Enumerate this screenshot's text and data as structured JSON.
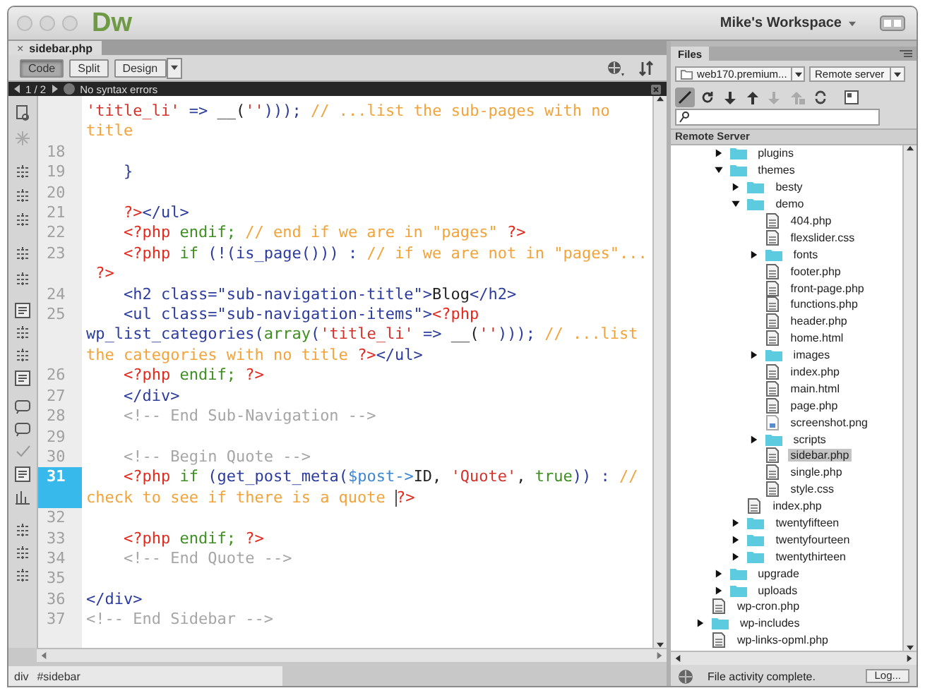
{
  "app": {
    "logo": "Dw",
    "workspace": "Mike's Workspace"
  },
  "document_tab": {
    "close": "×",
    "title": "sidebar.php"
  },
  "view_buttons": [
    {
      "label": "Code",
      "selected": true
    },
    {
      "label": "Split",
      "selected": false
    },
    {
      "label": "Design",
      "selected": false
    }
  ],
  "info_bar": {
    "page": "1 / 2",
    "message": "No syntax errors"
  },
  "code_rows": [
    {
      "current": false,
      "tokens": [
        {
          "kind": "string",
          "text": "'title_li'"
        },
        {
          "kind": "markup",
          "text": " => "
        },
        {
          "kind": "plain",
          "text": "__("
        },
        {
          "kind": "string",
          "text": "''"
        },
        {
          "kind": "markup",
          "text": ")));"
        },
        {
          "kind": "comment",
          "text": " // ...list the sub-pages with no"
        }
      ]
    },
    {
      "current": false,
      "tokens": [
        {
          "kind": "comment",
          "text": "title"
        }
      ]
    },
    {
      "number": "18",
      "current": false,
      "tokens": []
    },
    {
      "number": "19",
      "current": false,
      "tokens": [
        {
          "kind": "markup",
          "text": "    }"
        }
      ]
    },
    {
      "number": "20",
      "current": false,
      "tokens": []
    },
    {
      "number": "21",
      "current": false,
      "tokens": [
        {
          "kind": "tag",
          "text": "    ?>"
        },
        {
          "kind": "markup",
          "text": "</ul>"
        }
      ]
    },
    {
      "number": "22",
      "current": false,
      "tokens": [
        {
          "kind": "tag",
          "text": "    <?php"
        },
        {
          "kind": "keyword",
          "text": " endif;"
        },
        {
          "kind": "comment",
          "text": " // end if we are in \"pages\""
        },
        {
          "kind": "tag",
          "text": " ?>"
        }
      ]
    },
    {
      "number": "23",
      "current": false,
      "tokens": [
        {
          "kind": "tag",
          "text": "    <?php"
        },
        {
          "kind": "keyword",
          "text": " if"
        },
        {
          "kind": "markup",
          "text": " (!(is_page())) :"
        },
        {
          "kind": "comment",
          "text": " // if we are not in \"pages\"..."
        }
      ]
    },
    {
      "current": false,
      "tokens": [
        {
          "kind": "tag",
          "text": " ?>"
        }
      ]
    },
    {
      "number": "24",
      "current": false,
      "tokens": [
        {
          "kind": "markup",
          "text": "    <h2 class=\"sub-navigation-title\">"
        },
        {
          "kind": "plain",
          "text": "Blog"
        },
        {
          "kind": "markup",
          "text": "</h2>"
        }
      ]
    },
    {
      "number": "25",
      "current": false,
      "tokens": [
        {
          "kind": "markup",
          "text": "    <ul class=\"sub-navigation-items\">"
        },
        {
          "kind": "tag",
          "text": "<?php"
        }
      ]
    },
    {
      "current": false,
      "tokens": [
        {
          "kind": "markup",
          "text": "wp_list_categories("
        },
        {
          "kind": "keyword",
          "text": "array"
        },
        {
          "kind": "markup",
          "text": "("
        },
        {
          "kind": "string",
          "text": "'title_li'"
        },
        {
          "kind": "markup",
          "text": " => "
        },
        {
          "kind": "plain",
          "text": "__("
        },
        {
          "kind": "string",
          "text": "''"
        },
        {
          "kind": "markup",
          "text": ")));"
        },
        {
          "kind": "comment",
          "text": " // ...list"
        }
      ]
    },
    {
      "current": false,
      "tokens": [
        {
          "kind": "comment",
          "text": "the categories with no title "
        },
        {
          "kind": "tag",
          "text": "?>"
        },
        {
          "kind": "markup",
          "text": "</ul>"
        }
      ]
    },
    {
      "number": "26",
      "current": false,
      "tokens": [
        {
          "kind": "tag",
          "text": "    <?php"
        },
        {
          "kind": "keyword",
          "text": " endif;"
        },
        {
          "kind": "tag",
          "text": " ?>"
        }
      ]
    },
    {
      "number": "27",
      "current": false,
      "tokens": [
        {
          "kind": "markup",
          "text": "    </div>"
        }
      ]
    },
    {
      "number": "28",
      "current": false,
      "tokens": [
        {
          "kind": "htmlcomment",
          "text": "    <!-- End Sub-Navigation -->"
        }
      ]
    },
    {
      "number": "29",
      "current": false,
      "tokens": []
    },
    {
      "number": "30",
      "current": false,
      "tokens": [
        {
          "kind": "htmlcomment",
          "text": "    <!-- Begin Quote -->"
        }
      ]
    },
    {
      "number": "31",
      "current": true,
      "tokens": [
        {
          "kind": "tag",
          "text": "    <?php"
        },
        {
          "kind": "keyword",
          "text": " if"
        },
        {
          "kind": "markup",
          "text": " (get_post_meta("
        },
        {
          "kind": "variable",
          "text": "$post->"
        },
        {
          "kind": "plain",
          "text": "ID, "
        },
        {
          "kind": "string",
          "text": "'Quote'"
        },
        {
          "kind": "plain",
          "text": ", "
        },
        {
          "kind": "keyword",
          "text": "true"
        },
        {
          "kind": "markup",
          "text": ")) :"
        },
        {
          "kind": "comment",
          "text": " //"
        }
      ]
    },
    {
      "current": true,
      "tokens": [
        {
          "kind": "comment",
          "text": "check to see if there is a quote "
        },
        {
          "kind": "tag",
          "text": "?>",
          "caret": true
        }
      ]
    },
    {
      "number": "32",
      "current": false,
      "tokens": []
    },
    {
      "number": "33",
      "current": false,
      "tokens": [
        {
          "kind": "tag",
          "text": "    <?php"
        },
        {
          "kind": "keyword",
          "text": " endif;"
        },
        {
          "kind": "tag",
          "text": " ?>"
        }
      ]
    },
    {
      "number": "34",
      "current": false,
      "tokens": [
        {
          "kind": "htmlcomment",
          "text": "    <!-- End Quote -->"
        }
      ]
    },
    {
      "number": "35",
      "current": false,
      "tokens": []
    },
    {
      "number": "36",
      "current": false,
      "tokens": [
        {
          "kind": "markup",
          "text": "</div>"
        }
      ]
    },
    {
      "number": "37",
      "current": false,
      "tokens": [
        {
          "kind": "htmlcomment",
          "text": "<!-- End Sidebar -->"
        }
      ]
    }
  ],
  "tag_selector": [
    "div",
    "#sidebar"
  ],
  "files_panel": {
    "tab": "Files",
    "site": "web170.premium...",
    "server_view": "Remote server",
    "header": "Remote Server",
    "tree": {
      "continued": [
        {
          "kind": "folder",
          "label": "plugins",
          "expanded": false,
          "selected": false
        },
        {
          "kind": "folder",
          "label": "themes",
          "expanded": true,
          "selected": false,
          "children": [
            {
              "kind": "folder",
              "label": "besty",
              "expanded": false,
              "selected": false
            },
            {
              "kind": "folder",
              "label": "demo",
              "expanded": true,
              "selected": false,
              "children": [
                {
                  "kind": "file",
                  "label": "404.php",
                  "selected": false
                },
                {
                  "kind": "file",
                  "label": "flexslider.css",
                  "selected": false
                },
                {
                  "kind": "folder",
                  "label": "fonts",
                  "expanded": false,
                  "selected": false
                },
                {
                  "kind": "file",
                  "label": "footer.php",
                  "selected": false
                },
                {
                  "kind": "file",
                  "label": "front-page.php",
                  "selected": false
                },
                {
                  "kind": "file",
                  "label": "functions.php",
                  "selected": false
                },
                {
                  "kind": "file",
                  "label": "header.php",
                  "selected": false
                },
                {
                  "kind": "file",
                  "label": "home.html",
                  "selected": false
                },
                {
                  "kind": "folder",
                  "label": "images",
                  "expanded": false,
                  "selected": false
                },
                {
                  "kind": "file",
                  "label": "index.php",
                  "selected": false
                },
                {
                  "kind": "file",
                  "label": "main.html",
                  "selected": false
                },
                {
                  "kind": "file",
                  "label": "page.php",
                  "selected": false
                },
                {
                  "kind": "image",
                  "label": "screenshot.png",
                  "selected": false
                },
                {
                  "kind": "folder",
                  "label": "scripts",
                  "expanded": false,
                  "selected": false
                },
                {
                  "kind": "file",
                  "label": "sidebar.php",
                  "selected": true
                },
                {
                  "kind": "file",
                  "label": "single.php",
                  "selected": false
                },
                {
                  "kind": "file",
                  "label": "style.css",
                  "selected": false
                }
              ]
            },
            {
              "kind": "file",
              "label": "index.php",
              "selected": false
            },
            {
              "kind": "folder",
              "label": "twentyfifteen",
              "expanded": false,
              "selected": false
            },
            {
              "kind": "folder",
              "label": "twentyfourteen",
              "expanded": false,
              "selected": false
            },
            {
              "kind": "folder",
              "label": "twentythirteen",
              "expanded": false,
              "selected": false
            }
          ]
        },
        {
          "kind": "folder",
          "label": "upgrade",
          "expanded": false,
          "selected": false
        },
        {
          "kind": "folder",
          "label": "uploads",
          "expanded": false,
          "selected": false
        }
      ],
      "items": [
        {
          "kind": "file",
          "label": "wp-cron.php",
          "selected": false
        },
        {
          "kind": "folder",
          "label": "wp-includes",
          "expanded": false,
          "selected": false
        },
        {
          "kind": "file",
          "label": "wp-links-opml.php",
          "selected": false
        }
      ]
    },
    "status": "File activity complete.",
    "log_button": "Log..."
  }
}
